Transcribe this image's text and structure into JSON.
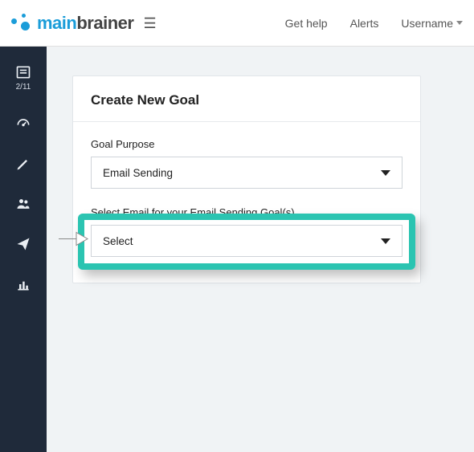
{
  "topbar": {
    "brand_part1": "main",
    "brand_part2": "brainer",
    "help_label": "Get help",
    "alerts_label": "Alerts",
    "username_label": "Username"
  },
  "sidebar": {
    "progress_label": "2/11"
  },
  "card": {
    "title": "Create New Goal",
    "purpose_label": "Goal Purpose",
    "purpose_value": "Email Sending",
    "select_email_label": "Select Email for your Email Sending Goal(s)",
    "select_email_value": "Select"
  }
}
